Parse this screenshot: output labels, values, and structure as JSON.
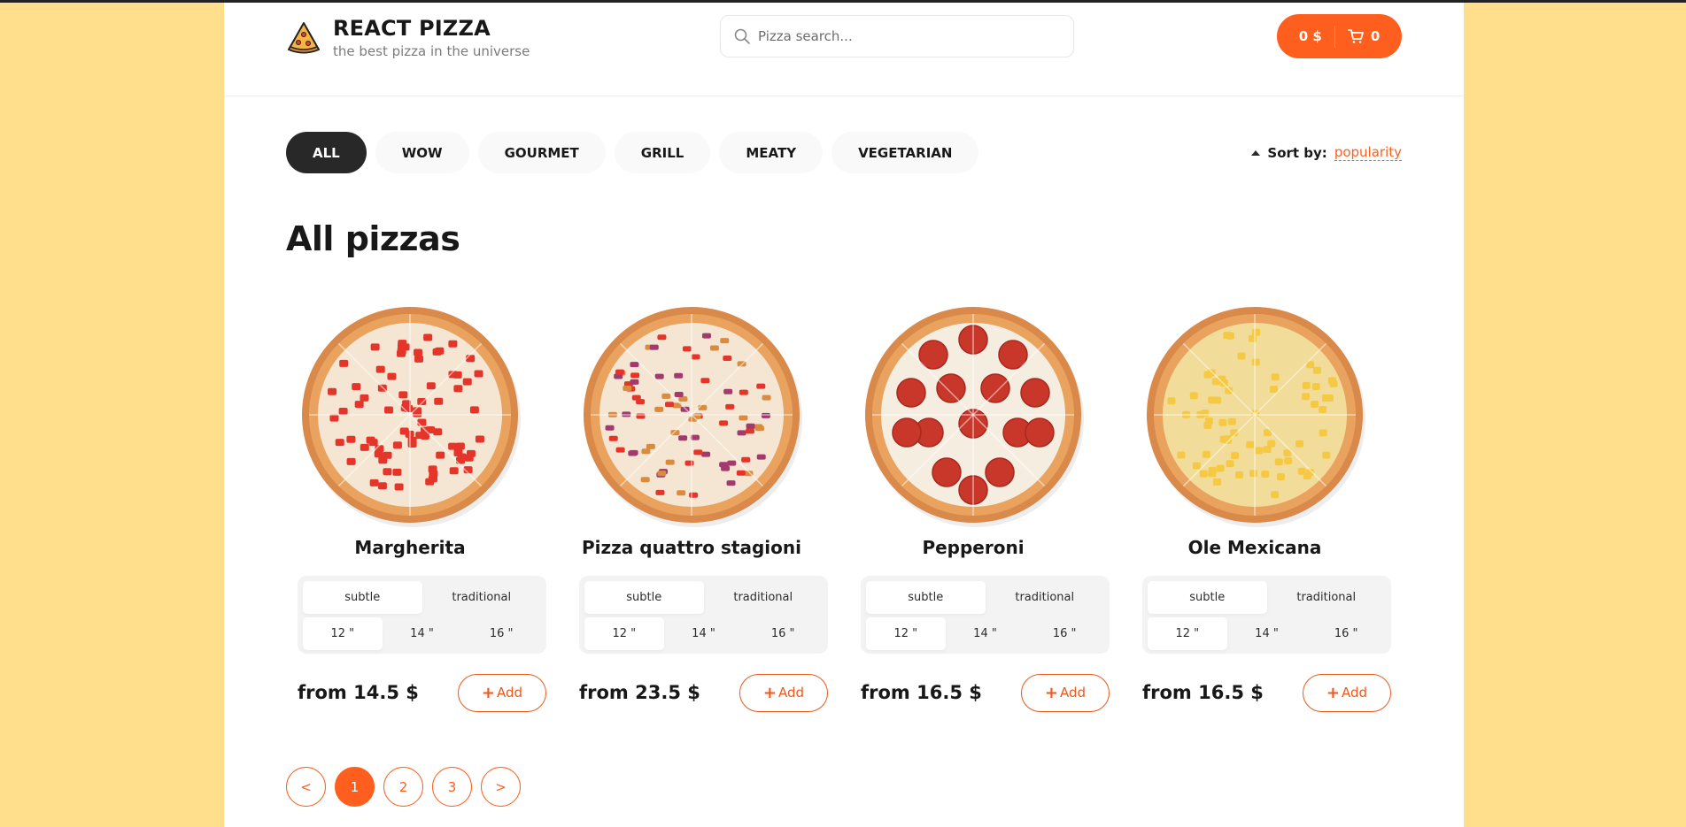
{
  "header": {
    "logo_title": "REACT PIZZA",
    "logo_subtitle": "the best pizza in the universe",
    "search_placeholder": "Pizza search...",
    "cart_total": "0 $",
    "cart_count": "0"
  },
  "categories": [
    "ALL",
    "WOW",
    "GOURMET",
    "GRILL",
    "MEATY",
    "VEGETARIAN"
  ],
  "active_category": "ALL",
  "sort": {
    "label": "Sort by:",
    "value": "popularity"
  },
  "page_title": "All pizzas",
  "pizzas": [
    {
      "name": "Margherita",
      "types": [
        "subtle",
        "traditional"
      ],
      "sizes": [
        "12 \"",
        "14 \"",
        "16 \""
      ],
      "price": "from 14.5 $",
      "add_label": "Add",
      "topping": "tomato"
    },
    {
      "name": "Pizza quattro stagioni",
      "types": [
        "subtle",
        "traditional"
      ],
      "sizes": [
        "12 \"",
        "14 \"",
        "16 \""
      ],
      "price": "from 23.5 $",
      "add_label": "Add",
      "topping": "mixed"
    },
    {
      "name": "Pepperoni",
      "types": [
        "subtle",
        "traditional"
      ],
      "sizes": [
        "12 \"",
        "14 \"",
        "16 \""
      ],
      "price": "from 16.5 $",
      "add_label": "Add",
      "topping": "pepperoni"
    },
    {
      "name": "Ole Mexicana",
      "types": [
        "subtle",
        "traditional"
      ],
      "sizes": [
        "12 \"",
        "14 \"",
        "16 \""
      ],
      "price": "from 16.5 $",
      "add_label": "Add",
      "topping": "pineapple"
    }
  ],
  "pagination": {
    "prev": "<",
    "pages": [
      "1",
      "2",
      "3"
    ],
    "next": ">",
    "active": "1"
  },
  "colors": {
    "accent": "#fe5f1e",
    "background": "#ffdf8c",
    "dark": "#282828"
  }
}
